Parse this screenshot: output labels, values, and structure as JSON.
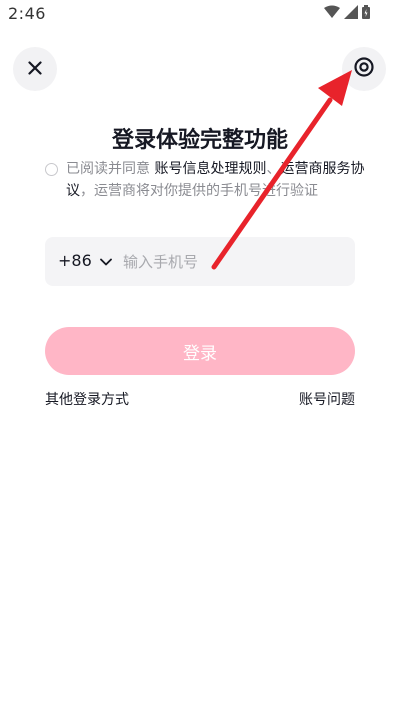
{
  "status_bar": {
    "time": "2:46"
  },
  "header": {
    "close_icon": "close-icon",
    "help_icon": "target-circle-icon"
  },
  "title": "登录体验完整功能",
  "agreement": {
    "prefix": "已阅读并同意 ",
    "link1": "账号信息处理规则",
    "separator": "、",
    "link2": "运营商服务协议",
    "suffix": "，运营商将对你提供的手机号进行验证"
  },
  "phone": {
    "country_code": "+86",
    "placeholder": "输入手机号"
  },
  "login_button": "登录",
  "links": {
    "other_login": "其他登录方式",
    "account_issue": "账号问题"
  },
  "colors": {
    "primary_disabled": "#ffb6c6",
    "annotation_arrow": "#e8232b"
  }
}
